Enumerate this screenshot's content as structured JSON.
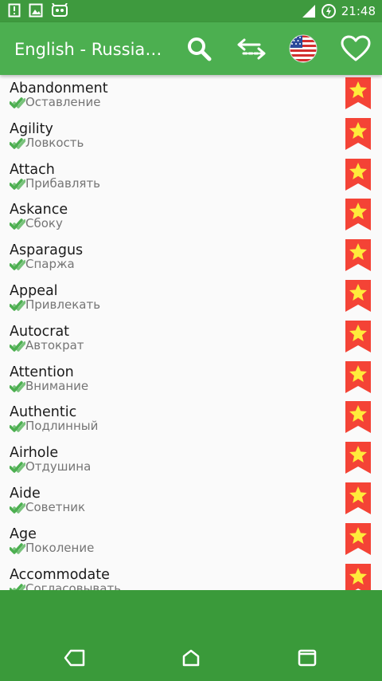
{
  "status": {
    "time": "21:48"
  },
  "toolbar": {
    "title": "English - Russian...",
    "icons": [
      "search-icon",
      "swap-icon",
      "us-flag-icon",
      "heart-icon"
    ]
  },
  "words": [
    {
      "word": "Abandonment",
      "translation": "Оставление"
    },
    {
      "word": "Agility",
      "translation": "Ловкость"
    },
    {
      "word": "Attach",
      "translation": "Прибавлять"
    },
    {
      "word": "Askance",
      "translation": "Сбоку"
    },
    {
      "word": "Asparagus",
      "translation": "Спаржа"
    },
    {
      "word": "Appeal",
      "translation": "Привлекать"
    },
    {
      "word": "Autocrat",
      "translation": "Автократ"
    },
    {
      "word": "Attention",
      "translation": "Внимание"
    },
    {
      "word": "Authentic",
      "translation": "Подлинный"
    },
    {
      "word": "Airhole",
      "translation": "Отдушина"
    },
    {
      "word": "Aide",
      "translation": "Советник"
    },
    {
      "word": "Age",
      "translation": "Поколение"
    },
    {
      "word": "Accommodate",
      "translation": "Согласовывать"
    }
  ],
  "colors": {
    "toolbar": "#4caf50",
    "statusbar": "#3e9a3e",
    "check": "#4caf50",
    "bookmark": "#f44336",
    "star": "#ffeb3b"
  }
}
